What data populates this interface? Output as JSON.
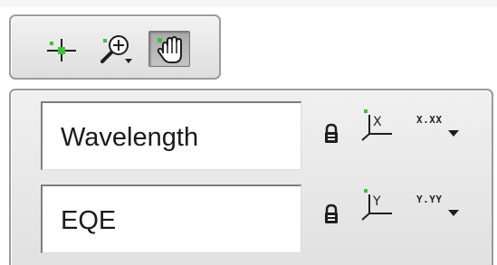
{
  "tool_palette": {
    "tools": [
      {
        "id": "cursor",
        "icon": "crosshair-cursor-icon",
        "active": false
      },
      {
        "id": "zoom",
        "icon": "zoom-icon",
        "active": false
      },
      {
        "id": "pan",
        "icon": "pan-hand-icon",
        "active": true
      }
    ]
  },
  "axes": {
    "x": {
      "name": "Wavelength",
      "lock_icon": "lock-icon",
      "scale_icon": "x-axis-scale-icon",
      "scale_letter": "X",
      "format_icon": "x-format-icon",
      "format_text": "X.XX"
    },
    "y": {
      "name": "EQE",
      "lock_icon": "lock-icon",
      "scale_icon": "y-axis-scale-icon",
      "scale_letter": "Y",
      "format_icon": "y-format-icon",
      "format_text": "Y.YY"
    }
  },
  "colors": {
    "accent_green": "#39c43a",
    "panel_bg": "#e8e8e8",
    "active_button": "#b4b4b4"
  }
}
